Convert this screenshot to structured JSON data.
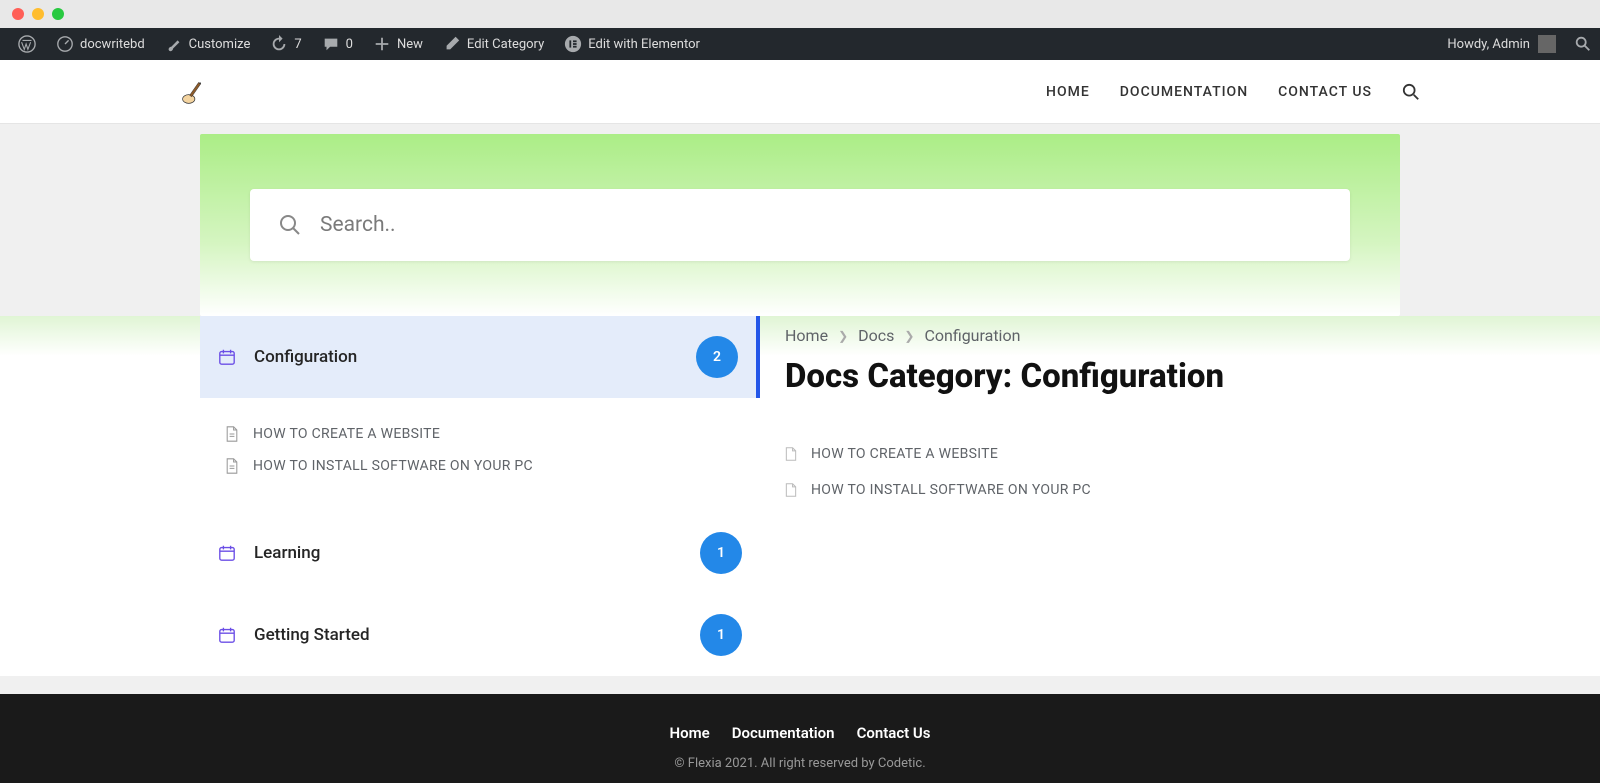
{
  "wp_bar": {
    "site_name": "docwritebd",
    "customize": "Customize",
    "updates_count": "7",
    "comments_count": "0",
    "new": "New",
    "edit_cat": "Edit Category",
    "elementor": "Edit with Elementor",
    "howdy": "Howdy, Admin"
  },
  "site_nav": {
    "home": "HOME",
    "documentation": "DOCUMENTATION",
    "contact": "CONTACT US"
  },
  "search": {
    "placeholder": "Search.."
  },
  "sidebar": {
    "categories": [
      {
        "label": "Configuration",
        "count": "2",
        "active": true
      },
      {
        "label": "Learning",
        "count": "1",
        "active": false
      },
      {
        "label": "Getting Started",
        "count": "1",
        "active": false
      }
    ],
    "sub_items": [
      "HOW TO CREATE A WEBSITE",
      "HOW TO INSTALL SOFTWARE ON YOUR PC"
    ]
  },
  "breadcrumb": {
    "home": "Home",
    "docs": "Docs",
    "current": "Configuration"
  },
  "main": {
    "title": "Docs Category: Configuration",
    "docs": [
      "HOW TO CREATE A WEBSITE",
      "HOW TO INSTALL SOFTWARE ON YOUR PC"
    ]
  },
  "footer": {
    "nav": {
      "home": "Home",
      "documentation": "Documentation",
      "contact": "Contact Us"
    },
    "copy": "© Flexia 2021. All right reserved by Codetic."
  }
}
